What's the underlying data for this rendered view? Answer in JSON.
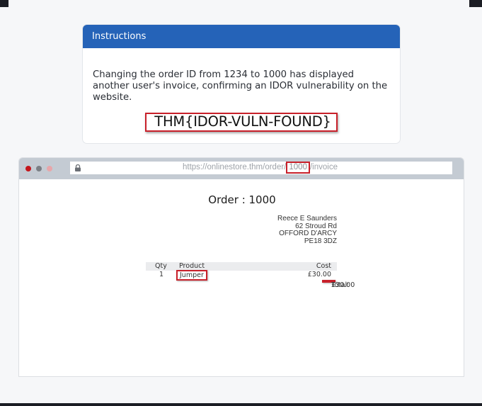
{
  "instructions": {
    "title": "Instructions",
    "text": "Changing the order ID from 1234 to 1000 has displayed another user's invoice, confirming an IDOR vulnerability on the website.",
    "flag": "THM{IDOR-VULN-FOUND}"
  },
  "browser": {
    "url_prefix": "https://onlinestore.thm/order/",
    "url_highlight": "1000",
    "url_suffix": "/invoice",
    "lock_icon": "lock-icon"
  },
  "invoice": {
    "title": "Order : 1000",
    "address": [
      "Reece E Saunders",
      "62 Stroud Rd",
      "OFFORD D'ARCY",
      "PE18 3DZ"
    ],
    "columns": {
      "qty": "Qty",
      "product": "Product",
      "cost": "Cost"
    },
    "rows": [
      {
        "qty": "1",
        "product": "Jumper",
        "cost": "£30.00"
      }
    ],
    "total_label": "Total:",
    "total_value": "£30.00"
  },
  "colors": {
    "header_blue": "#2563b8",
    "highlight_red": "#c8202a"
  }
}
